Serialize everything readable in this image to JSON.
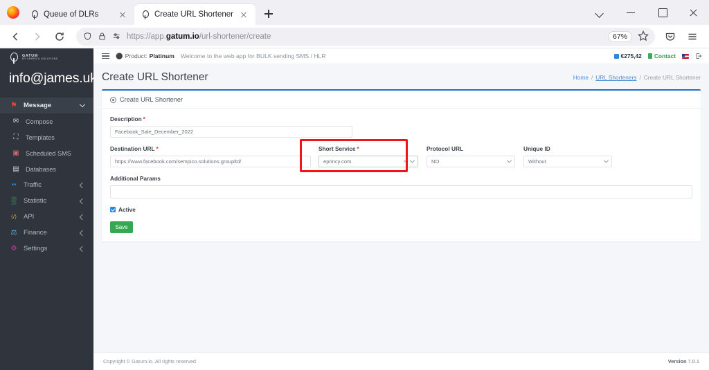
{
  "browser": {
    "tabs": [
      {
        "title": "Queue of DLRs",
        "active": false
      },
      {
        "title": "Create URL Shortener",
        "active": true
      }
    ],
    "url_prefix": "https://app.",
    "url_domain": "gatum.io",
    "url_path": "/url-shortener/create",
    "zoom_level": "67%",
    "icons": {
      "firefox_logo": "firefox-logo",
      "back": "back-arrow-icon",
      "forward": "forward-arrow-icon",
      "reload": "reload-icon",
      "shield": "shield-icon",
      "lock": "lock-icon",
      "reader": "reader-settings-icon",
      "bookmark": "star-icon",
      "pocket": "pocket-icon",
      "menu": "hamburger-menu-icon",
      "tab_list": "chevron-down-icon",
      "minimize": "minimize-icon",
      "maximize": "maximize-icon",
      "close": "close-icon"
    }
  },
  "sidebar": {
    "logo_line1": "GATUM",
    "logo_line2": "BY SEMPICO SOLUTIONS",
    "user_email": "info@james.uk",
    "items": [
      {
        "label": "Message",
        "icon": "message-icon",
        "color": "#e2403a",
        "glyph": "⚑",
        "active": true,
        "expandable": true,
        "expanded": true,
        "sub": false
      },
      {
        "label": "Compose",
        "icon": "envelope-icon",
        "color": "#c9ced4",
        "glyph": "✉",
        "active": false,
        "expandable": false,
        "expanded": false,
        "sub": true
      },
      {
        "label": "Templates",
        "icon": "template-icon",
        "color": "#c9ced4",
        "glyph": "⧉",
        "active": false,
        "expandable": false,
        "expanded": false,
        "sub": true
      },
      {
        "label": "Scheduled SMS",
        "icon": "calendar-icon",
        "color": "#d06b6b",
        "glyph": "Ὄ5",
        "active": false,
        "expandable": false,
        "expanded": false,
        "sub": true
      },
      {
        "label": "Databases",
        "icon": "database-icon",
        "color": "#c9ced4",
        "glyph": "▤",
        "active": false,
        "expandable": false,
        "expanded": false,
        "sub": true
      },
      {
        "label": "Traffic",
        "icon": "traffic-icon",
        "color": "#2f7fe0",
        "glyph": "▰",
        "active": false,
        "expandable": true,
        "expanded": false,
        "sub": false
      },
      {
        "label": "Statistic",
        "icon": "statistic-icon",
        "color": "#3faa5c",
        "glyph": "▒",
        "active": false,
        "expandable": true,
        "expanded": false,
        "sub": false
      },
      {
        "label": "API",
        "icon": "code-icon",
        "color": "#e8a22b",
        "glyph": "‹›",
        "active": false,
        "expandable": true,
        "expanded": false,
        "sub": false
      },
      {
        "label": "Finance",
        "icon": "finance-icon",
        "color": "#6ab4e8",
        "glyph": "⚖",
        "active": false,
        "expandable": true,
        "expanded": false,
        "sub": false
      },
      {
        "label": "Settings",
        "icon": "settings-icon",
        "color": "#d436a8",
        "glyph": "⚙",
        "active": false,
        "expandable": true,
        "expanded": false,
        "sub": false
      }
    ]
  },
  "topbar": {
    "menu_toggle": "hamburger-menu-icon",
    "product_label": "Product:",
    "product_value": "Platinum",
    "welcome_text": "Welcome to the web app for BULK sending SMS / HLR",
    "balance": "€275,42",
    "contact_label": "Contact",
    "flag_icon": "flag-icon",
    "logout_icon": "logout-icon"
  },
  "page": {
    "title": "Create URL Shortener",
    "breadcrumb": [
      {
        "label": "Home",
        "link": true
      },
      {
        "label": "URL Shorteners",
        "link": true
      },
      {
        "label": "Create URL Shortener",
        "link": false
      }
    ],
    "separator": "/"
  },
  "card": {
    "header_icon": "target-icon",
    "header_title": "Create URL Shortener",
    "fields": {
      "description": {
        "label": "Description",
        "required": true,
        "value": "Facebook_Sale_December_2022"
      },
      "destination_url": {
        "label": "Destination URL",
        "required": true,
        "value": "https://www.facebook.com/sempico.solutions.groupltd/"
      },
      "short_service": {
        "label": "Short Service",
        "required": true,
        "value": "eprincy.com",
        "clear_icon": "×",
        "caret_icon": "chevron-down-icon",
        "highlighted": true
      },
      "protocol_url": {
        "label": "Protocol URL",
        "required": false,
        "value": "NO"
      },
      "unique_id": {
        "label": "Unique ID",
        "required": false,
        "value": "Without"
      },
      "additional_params": {
        "label": "Additional Params",
        "required": false,
        "value": ""
      }
    },
    "active_checkbox": {
      "label": "Active",
      "checked": true
    },
    "save_button": "Save"
  },
  "footer": {
    "copyright": "Copyright © Gatum.io. All rights reserved",
    "version_label": "Version",
    "version_value": "7.0.1"
  },
  "colors": {
    "accent_blue": "#1a73c8",
    "save_green": "#34a853",
    "highlight_red": "#f01616",
    "sidebar_bg": "#2f343d"
  }
}
